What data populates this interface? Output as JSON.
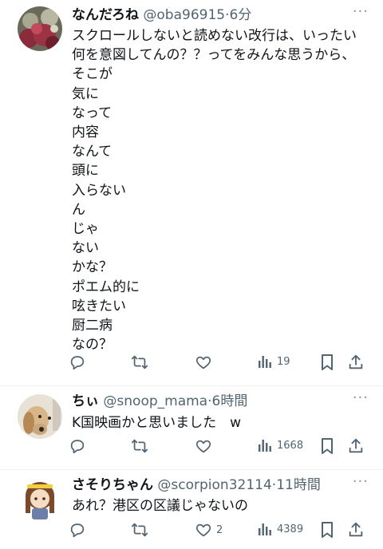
{
  "posts": [
    {
      "display_name": "なんだろね",
      "handle": "@oba96915",
      "separator": "·",
      "time": "6分",
      "text": "スクロールしないと読めない改行は、いったい\n何を意図してんの？？ってをみんな思うから、\nそこが\n気に\nなって\n内容\nなんて\n頭に\n入らない\nん\nじゃ\nない\nかな？\nポエム的に\n呟きたい\n厨二病\nなの？",
      "views": "19",
      "likes": ""
    },
    {
      "display_name": "ちぃ",
      "handle": "@snoop_mama",
      "separator": "·",
      "time": "6時間",
      "text": "K国映画かと思いました　w",
      "views": "1668",
      "likes": ""
    },
    {
      "display_name": "さそりちゃん",
      "handle": "@scorpion32114",
      "separator": "·",
      "time": "11時間",
      "text": "あれ？港区の区議じゃないの",
      "views": "4389",
      "likes": "2"
    }
  ],
  "more_label": "···",
  "colors": {
    "text": "#0f1419",
    "secondary": "#536471",
    "divider": "#eff3f4"
  }
}
